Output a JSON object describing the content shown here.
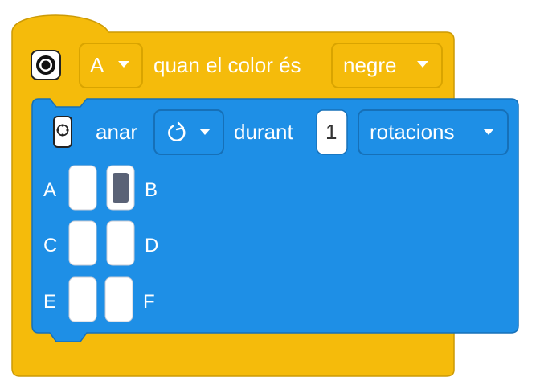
{
  "colors": {
    "event_block": "#F5BB0B",
    "event_block_border": "#CC9A05",
    "motor_block": "#1E8FE6",
    "motor_block_border": "#1670B8",
    "dropdown_border_on_yellow": "#D9A400",
    "dropdown_border_on_blue": "#1670B8",
    "port_selected": "#5A6276",
    "port_slot": "#FFFFFF"
  },
  "event_block": {
    "icon": "color-sensor-icon",
    "port_dropdown": "A",
    "label": "quan el color és",
    "color_dropdown": "negre"
  },
  "motor_block": {
    "icon": "motor-icon",
    "label_go": "anar",
    "direction_icon": "clockwise-arrow-icon",
    "label_for": "durant",
    "amount": "1",
    "unit_dropdown": "rotacions",
    "ports": [
      {
        "left": "A",
        "right": "B",
        "left_selected": false,
        "right_selected": true
      },
      {
        "left": "C",
        "right": "D",
        "left_selected": false,
        "right_selected": false
      },
      {
        "left": "E",
        "right": "F",
        "left_selected": false,
        "right_selected": false
      }
    ]
  }
}
